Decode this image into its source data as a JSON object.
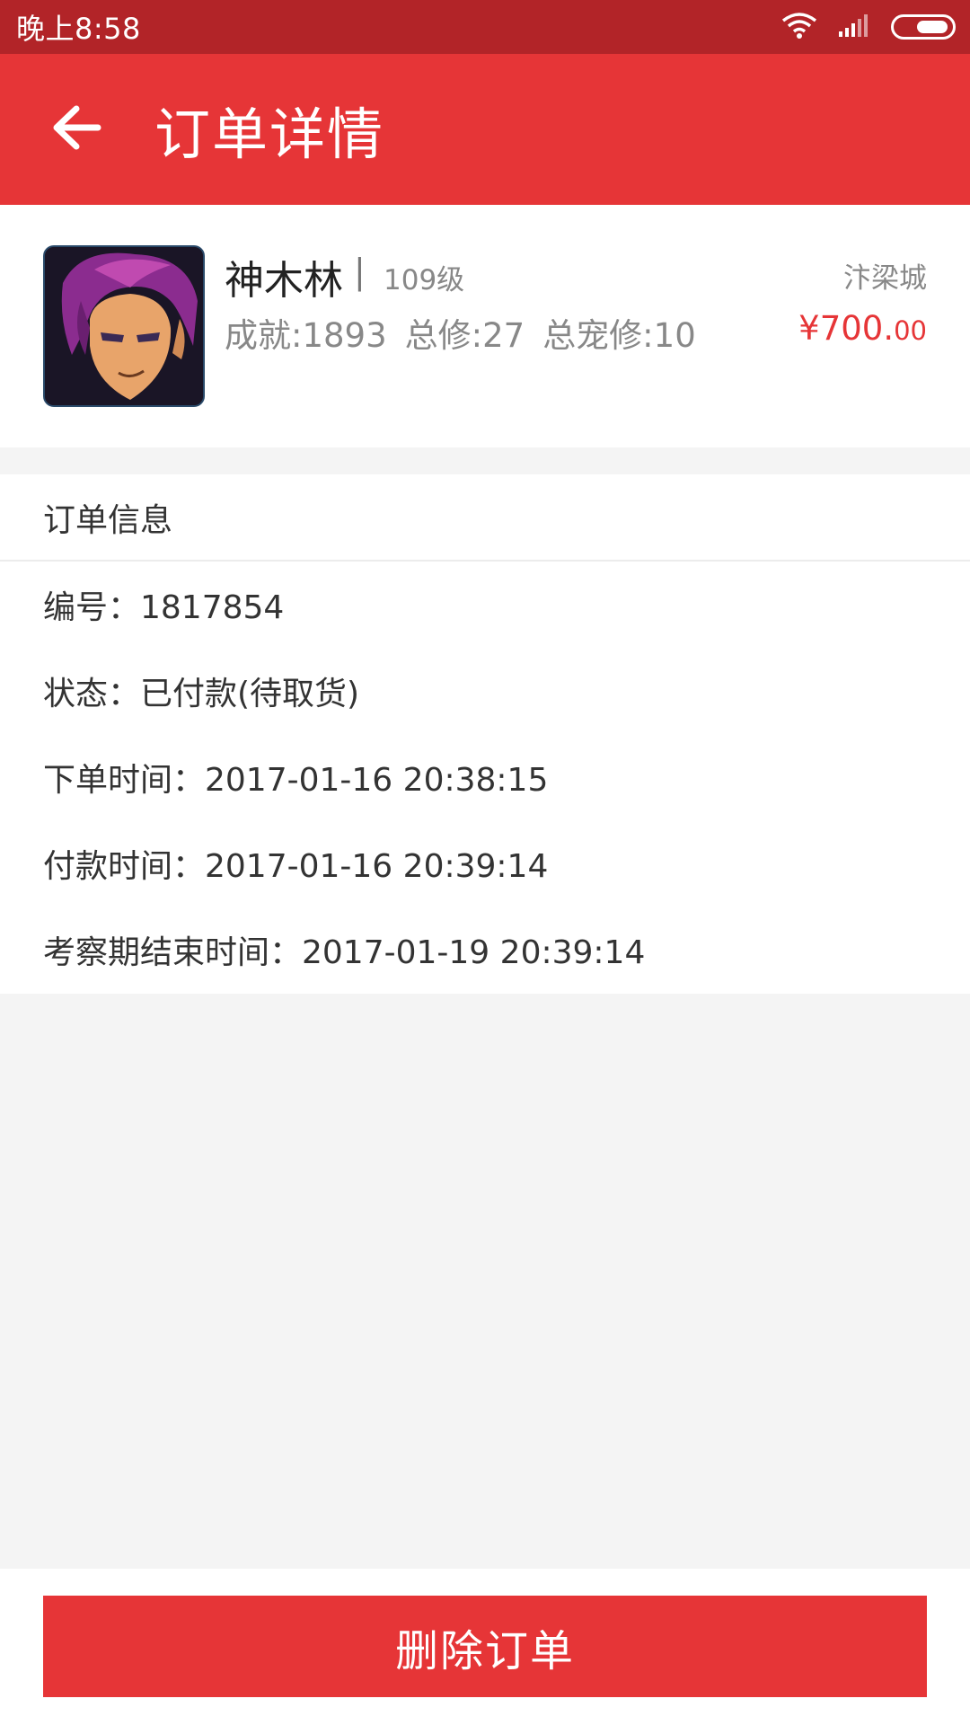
{
  "status_bar": {
    "time": "晚上8:58",
    "icons": [
      "wifi-icon",
      "signal-icon",
      "battery-icon"
    ]
  },
  "app_bar": {
    "back_icon": "arrow-left-icon",
    "title": "订单详情"
  },
  "product": {
    "name": "神木林",
    "separator": "|",
    "level": "109级",
    "stats": [
      "成就:1893",
      "总修:27",
      "总宠修:10"
    ],
    "server": "汴梁城",
    "price_int": "¥700.",
    "price_dec": "00"
  },
  "order_info": {
    "header": "订单信息",
    "rows": [
      "编号：1817854",
      "状态：已付款(待取货)",
      "下单时间：2017-01-16 20:38:15",
      "付款时间：2017-01-16 20:39:14",
      "考察期结束时间：2017-01-19 20:39:14"
    ]
  },
  "actions": {
    "delete_label": "删除订单"
  },
  "colors": {
    "status_bar": "#b22428",
    "primary": "#e63537",
    "background": "#f4f4f4"
  }
}
